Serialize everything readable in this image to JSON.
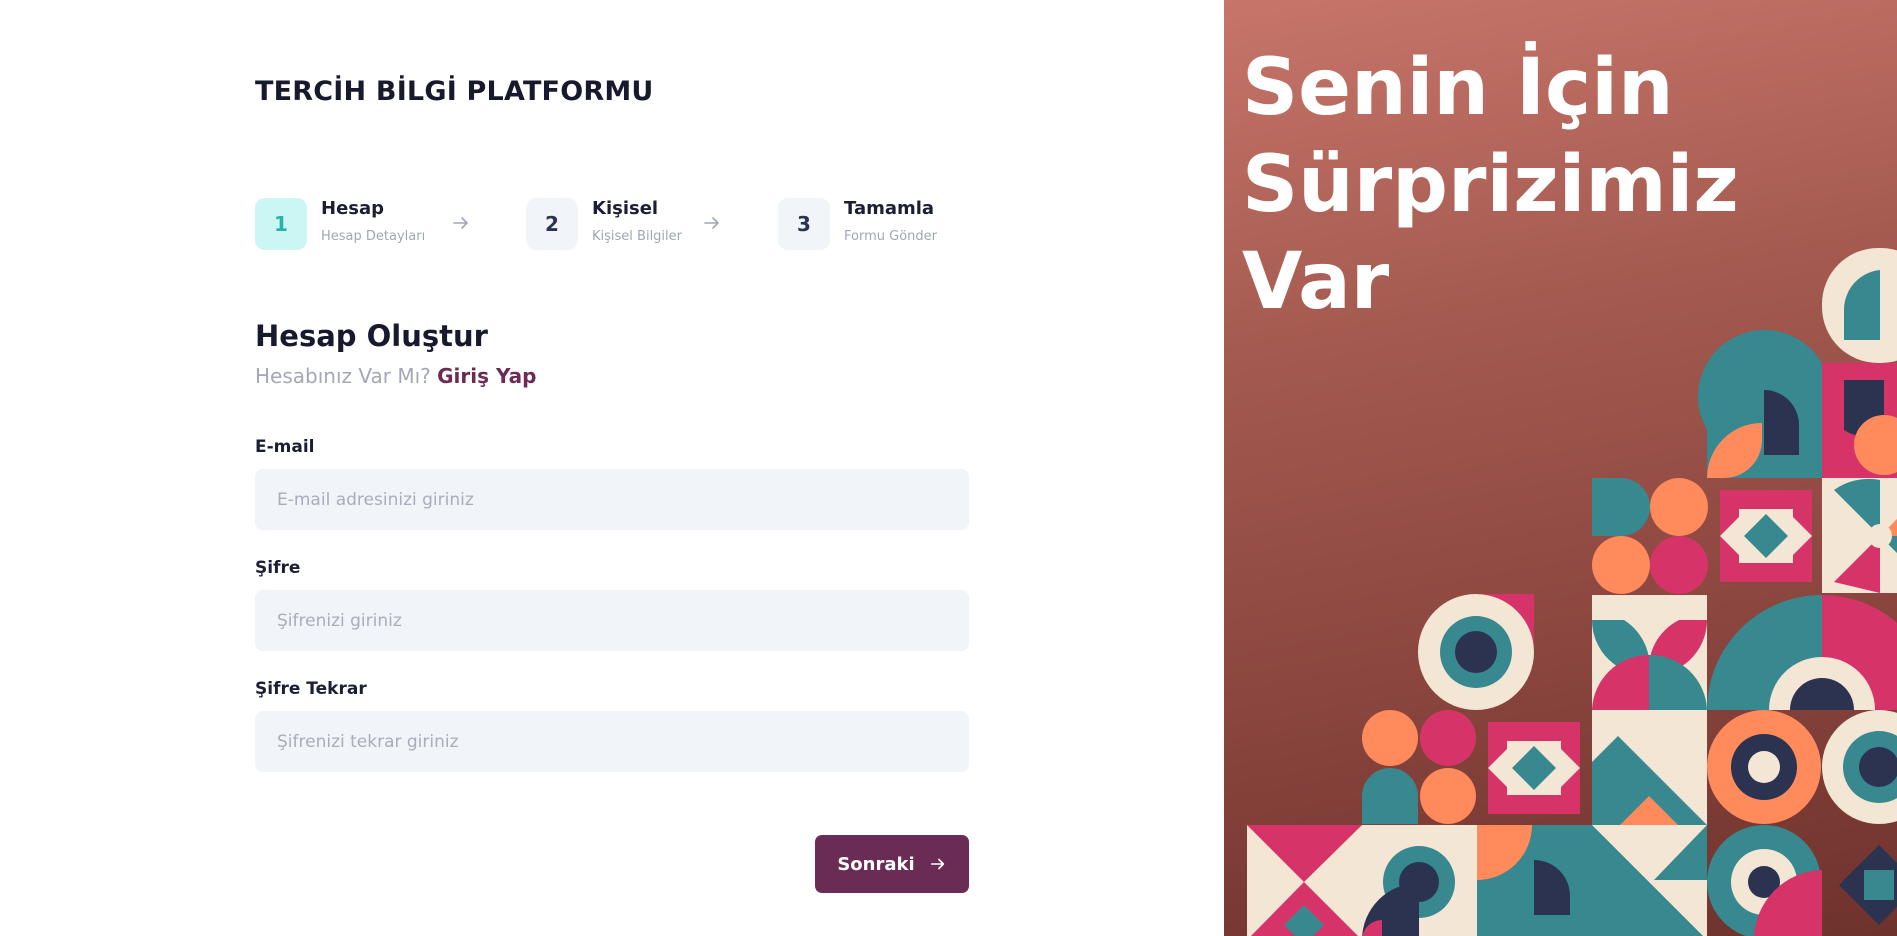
{
  "brand": "TERCİH BİLGİ PLATFORMU",
  "steps": [
    {
      "number": "1",
      "title": "Hesap",
      "subtitle": "Hesap Detayları",
      "active": true
    },
    {
      "number": "2",
      "title": "Kişisel",
      "subtitle": "Kişisel Bilgiler",
      "active": false
    },
    {
      "number": "3",
      "title": "Tamamla",
      "subtitle": "Formu Gönder",
      "active": false
    }
  ],
  "form": {
    "title": "Hesap Oluştur",
    "subtitle_prefix": "Hesabınız Var Mı?",
    "login_link": "Giriş Yap",
    "email": {
      "label": "E-mail",
      "placeholder": "E-mail adresinizi giriniz",
      "value": ""
    },
    "password": {
      "label": "Şifre",
      "placeholder": "Şifrenizi giriniz",
      "value": ""
    },
    "password_repeat": {
      "label": "Şifre Tekrar",
      "placeholder": "Şifrenizi tekrar giriniz",
      "value": ""
    },
    "next_label": "Sonraki",
    "next_icon": "arrow-right-icon"
  },
  "hero": {
    "lines": [
      "Senin İçin",
      "Sürprizimiz",
      "Var"
    ]
  },
  "colors": {
    "accent": "#6a2b55",
    "step_active_bg": "#ccf6f3",
    "step_active_text": "#26b4a6",
    "input_bg": "#f1f4f8",
    "panel_top": "#c7756a",
    "panel_bottom": "#6e322c",
    "pattern_teal": "#388890",
    "pattern_pink": "#d63468",
    "pattern_orange": "#ff8a5c",
    "pattern_cream": "#f3e6d4",
    "pattern_navy": "#2b3350"
  }
}
